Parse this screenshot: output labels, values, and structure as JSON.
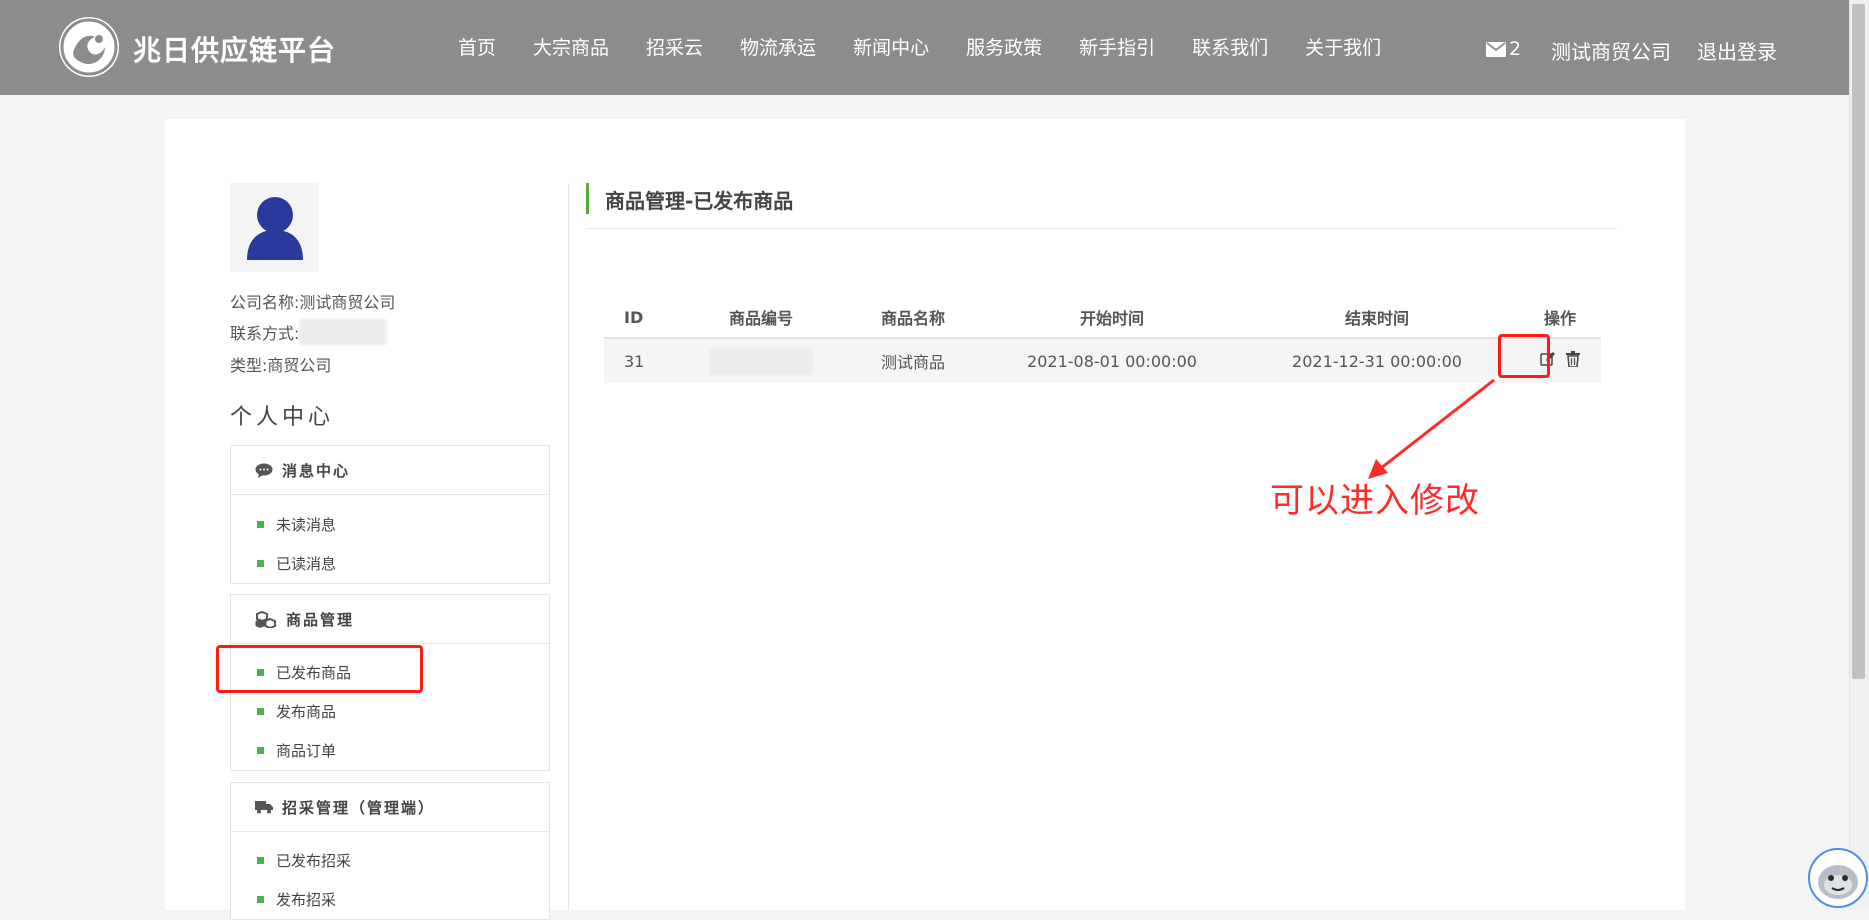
{
  "header": {
    "brand": "兆日供应链平台",
    "nav": [
      "首页",
      "大宗商品",
      "招采云",
      "物流承运",
      "新闻中心",
      "服务政策",
      "新手指引",
      "联系我们",
      "关于我们"
    ],
    "mail_count": "2",
    "company": "测试商贸公司",
    "logout": "退出登录"
  },
  "profile": {
    "company_label": "公司名称:",
    "company_value": "测试商贸公司",
    "contact_label": "联系方式:",
    "type_label": "类型:",
    "type_value": "商贸公司"
  },
  "sidebar": {
    "title": "个人中心",
    "groups": [
      {
        "label": "消息中心",
        "icon": "chat-icon",
        "items": [
          "未读消息",
          "已读消息"
        ]
      },
      {
        "label": "商品管理",
        "icon": "cubes-icon",
        "items": [
          "已发布商品",
          "发布商品",
          "商品订单"
        ]
      },
      {
        "label": "招采管理（管理端）",
        "icon": "truck-icon",
        "items": [
          "已发布招采",
          "发布招采"
        ]
      }
    ]
  },
  "main": {
    "title": "商品管理-已发布商品",
    "table": {
      "headers": [
        "ID",
        "商品编号",
        "商品名称",
        "开始时间",
        "结束时间",
        "操作"
      ],
      "rows": [
        {
          "id": "31",
          "name": "测试商品",
          "start": "2021-08-01 00:00:00",
          "end": "2021-12-31 00:00:00"
        }
      ]
    }
  },
  "annotation": "可以进入修改",
  "colors": {
    "header_bg": "#8c8c8c",
    "accent_green": "#4caf50",
    "annotation_red": "#ff2a2a",
    "avatar_blue": "#2a3a9c"
  }
}
